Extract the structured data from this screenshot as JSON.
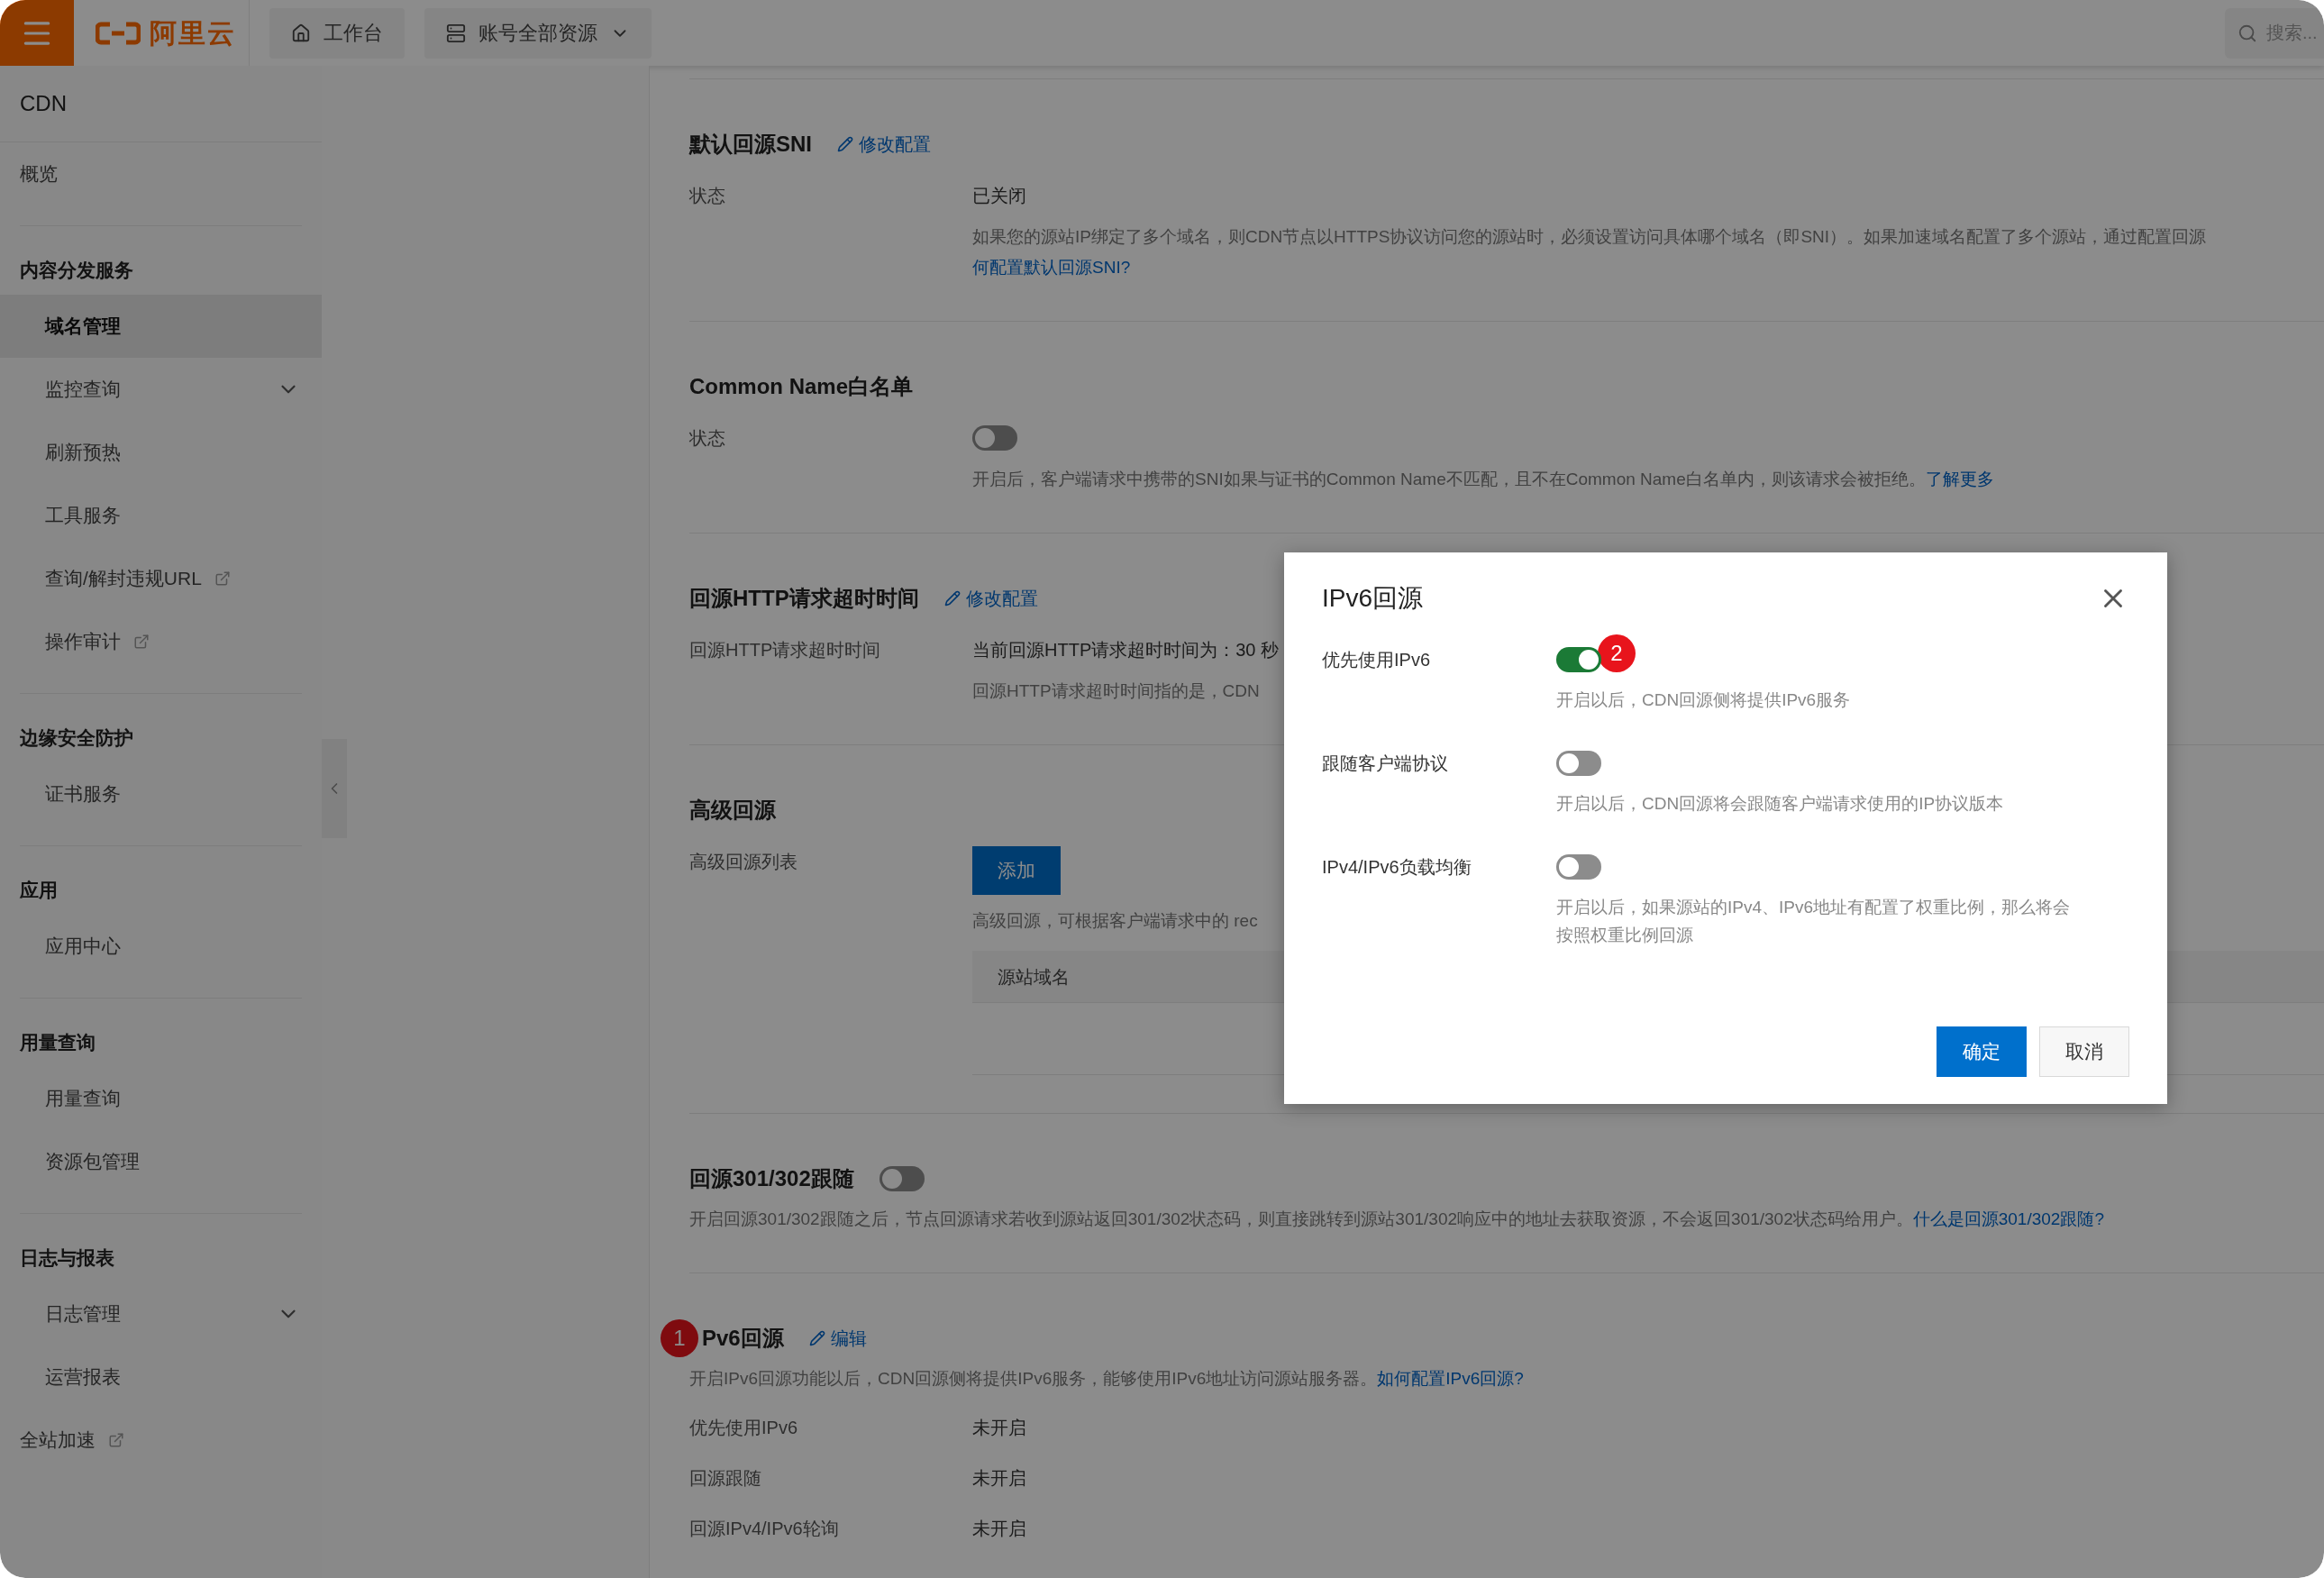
{
  "topbar": {
    "logo": "阿里云",
    "nav": [
      {
        "label": "工作台",
        "kind": "home"
      },
      {
        "label": "账号全部资源",
        "kind": "dropdown"
      }
    ],
    "search": {
      "placeholder": "搜索..."
    }
  },
  "sidebar": {
    "title": "CDN",
    "items": [
      {
        "kind": "top",
        "label": "概览",
        "selected": false
      },
      {
        "kind": "heading",
        "label": "内容分发服务"
      },
      {
        "kind": "sub",
        "label": "域名管理",
        "selected": true
      },
      {
        "kind": "sub",
        "label": "监控查询",
        "selected": false,
        "submenu": true
      },
      {
        "kind": "sub",
        "label": "刷新预热",
        "selected": false
      },
      {
        "kind": "sub",
        "label": "工具服务",
        "selected": false
      },
      {
        "kind": "sub",
        "label": "查询/解封违规URL",
        "selected": false,
        "external": true
      },
      {
        "kind": "sub",
        "label": "操作审计",
        "selected": false,
        "external": true
      },
      {
        "kind": "heading",
        "label": "边缘安全防护"
      },
      {
        "kind": "sub",
        "label": "证书服务",
        "selected": false
      },
      {
        "kind": "heading",
        "label": "应用"
      },
      {
        "kind": "sub",
        "label": "应用中心",
        "selected": false
      },
      {
        "kind": "heading",
        "label": "用量查询"
      },
      {
        "kind": "sub",
        "label": "用量查询",
        "selected": false
      },
      {
        "kind": "sub",
        "label": "资源包管理",
        "selected": false
      },
      {
        "kind": "heading",
        "label": "日志与报表"
      },
      {
        "kind": "sub",
        "label": "日志管理",
        "selected": false,
        "submenu": true
      },
      {
        "kind": "sub",
        "label": "运营报表",
        "selected": false
      },
      {
        "kind": "top",
        "label": "全站加速",
        "selected": false,
        "external": true
      }
    ]
  },
  "sections": [
    {
      "title": "默认回源SNI",
      "action": "修改配置",
      "rows": [
        {
          "label": "状态",
          "kind": "text",
          "value": "已关闭",
          "notes": [
            [
              {
                "text": "如果您的源站IP绑定了多个域名，则CDN节点以HTTPS协议访问您的源站时，必须设置访问具体哪个域名（即SNI）。如果加速域名配置了多个源站，通过配置回源"
              }
            ],
            [
              {
                "link": "何配置默认回源SNI?"
              }
            ]
          ]
        }
      ]
    },
    {
      "title": "Common Name白名单",
      "rows": [
        {
          "label": "状态",
          "kind": "toggle",
          "on": false,
          "notes": [
            [
              {
                "text": "开启后，客户端请求中携带的SNI如果与证书的Common Name不匹配，且不在Common Name白名单内，则该请求会被拒绝。"
              },
              {
                "link": "了解更多"
              }
            ]
          ]
        }
      ]
    },
    {
      "title": "回源HTTP请求超时时间",
      "action": "修改配置",
      "rows": [
        {
          "label": "回源HTTP请求超时时间",
          "kind": "text",
          "value": "当前回源HTTP请求超时时间为：30 秒",
          "notes": [
            [
              {
                "text": "回源HTTP请求超时时间指的是，CDN"
              }
            ]
          ]
        }
      ]
    },
    {
      "title": "高级回源",
      "rows": [
        {
          "label": "高级回源列表",
          "kind": "button",
          "value": "添加",
          "notes": [
            [
              {
                "text": "高级回源，可根据客户端请求中的 rec"
              }
            ]
          ],
          "table": {
            "columns": [
              "源站域名"
            ]
          }
        }
      ]
    },
    {
      "title": "回源301/302跟随",
      "toggle": {
        "on": false
      },
      "description": [
        {
          "text": "开启回源301/302跟随之后，节点回源请求若收到源站返回301/302状态码，则直接跳转到源站301/302响应中的地址去获取资源，不会返回301/302状态码给用户。"
        },
        {
          "link": "什么是回源301/302跟随?"
        }
      ]
    },
    {
      "badge": "1",
      "title": "Pv6回源",
      "action": "编辑",
      "description": [
        {
          "text": "开启IPv6回源功能以后，CDN回源侧将提供IPv6服务，能够使用IPv6地址访问源站服务器。"
        },
        {
          "link": "如何配置IPv6回源?"
        }
      ],
      "rows": [
        {
          "label": "优先使用IPv6",
          "kind": "plain",
          "value": "未开启"
        },
        {
          "label": "回源跟随",
          "kind": "plain",
          "value": "未开启"
        },
        {
          "label": "回源IPv4/IPv6轮询",
          "kind": "plain",
          "value": "未开启"
        }
      ]
    }
  ],
  "modal": {
    "title": "IPv6回源",
    "fields": [
      {
        "label": "优先使用IPv6",
        "on": true,
        "note": "开启以后，CDN回源侧将提供IPv6服务",
        "badge": "2"
      },
      {
        "label": "跟随客户端协议",
        "on": false,
        "note": "开启以后，CDN回源将会跟随客户端请求使用的IP协议版本"
      },
      {
        "label": "IPv4/IPv6负载均衡",
        "on": false,
        "note": "开启以后，如果源站的IPv4、IPv6地址有配置了权重比例，那么将会按照权重比例回源"
      }
    ],
    "buttons": [
      {
        "label": "确定",
        "kind": "primary"
      },
      {
        "label": "取消",
        "kind": "default"
      }
    ]
  }
}
